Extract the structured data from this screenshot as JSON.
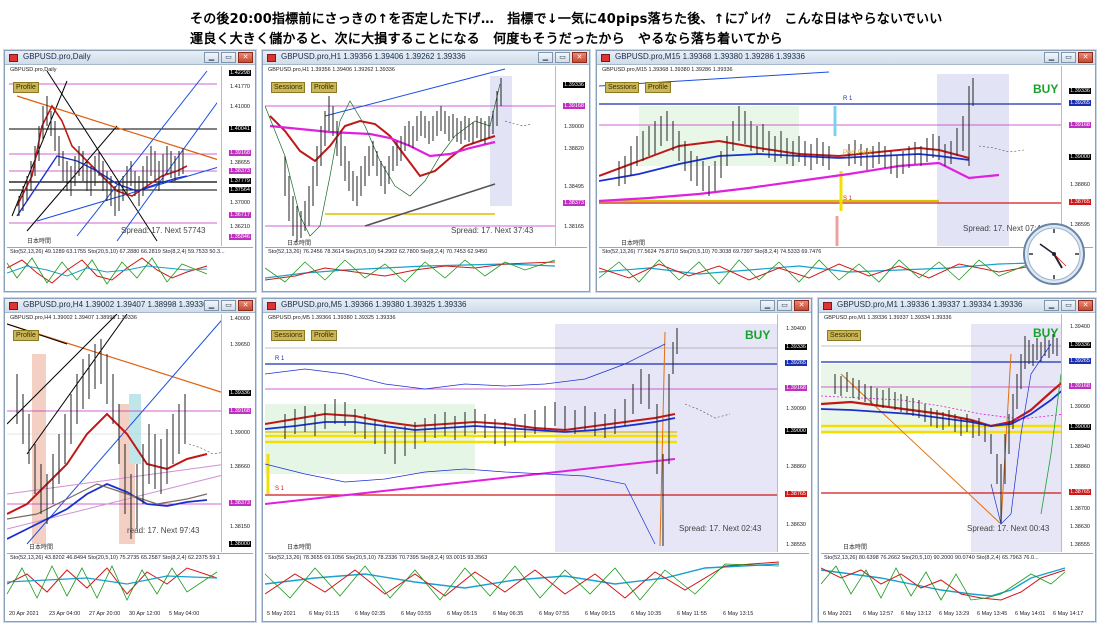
{
  "header": {
    "line1": "その後20:00指標前にさっきの↑を否定した下げ…　指標で↓一気に40pips落ちた後、↑にﾌﾞﾚｲｸ　こんな日はやらないでいい",
    "line2": "運良く大きく儲かると、次に大損することになる　何度もそうだったから　やるなら落ち着いてから"
  },
  "colors": {
    "buy": "#17a32a",
    "tag": "#c9b75a",
    "ma_red": "#c01818",
    "ma_blue": "#1a2fd0",
    "ma_magenta": "#e020e0",
    "price_box_blue": "#1a2fb0",
    "price_box_red": "#d01818"
  },
  "windows": [
    {
      "id": "daily",
      "title": "GBPUSD.pro,Daily",
      "tags": [
        "Profile"
      ],
      "prices": [
        "1.42298",
        "1.41770",
        "1.41000",
        "1.40041",
        "1.39168",
        "1.38655",
        "1.38373",
        "1.37779",
        "1.37564",
        "1.37000",
        "1.36717",
        "1.36210",
        "1.35846"
      ],
      "spread": "Spread: 17.  Next 57743",
      "session_label": "日本時間",
      "sub_label": "Sto(52,13,26) 49.1289 63.1755  Sto(20,5,10) 67.2880 66.2819  Sto(8,2,4) 59.7533 50.3...",
      "time_labels": []
    },
    {
      "id": "h1",
      "title": "GBPUSD.pro,H1  1.39356 1.39406 1.39262 1.39336",
      "tags": [
        "Sessions",
        "Profile"
      ],
      "prices": [
        "1.39336",
        "1.39168",
        "1.39000",
        "1.38820",
        "1.38495",
        "1.38373",
        "1.38165"
      ],
      "spread": "Spread: 17.  Next 37:43",
      "session_label": "日本時間",
      "sub_label": "Sto(52,13,26) 76.2456 78.3614  Sto(20,5,10) 54.2902 62.7800  Sto(8,2,4) 70.7453 62.9450",
      "time_labels": []
    },
    {
      "id": "m15",
      "title": "GBPUSD.pro,M15  1.39368 1.39380 1.39286 1.39336",
      "tags": [
        "Sessions",
        "Profile"
      ],
      "buy": "BUY",
      "pivot_labels": [
        "R 1",
        "S 1",
        "Pivot Point"
      ],
      "prices": [
        "1.39336",
        "1.39265",
        "1.39168",
        "1.39000",
        "1.38860",
        "1.38765",
        "1.38595"
      ],
      "spread": "Spread: 17.  Next 07:43",
      "session_label": "日本時間",
      "sub_label": "Sto(52,13,26) 77.5624 75.8710  Sto(20,5,10) 70.3038 69.7397  Sto(8,2,4) 74.5333 69.7476",
      "time_labels": []
    },
    {
      "id": "h4",
      "title": "GBPUSD.pro,H4  1.39002 1.39407 1.38998 1.39336",
      "tags": [
        "Profile"
      ],
      "prices": [
        "1.40000",
        "1.39650",
        "1.39336",
        "1.39168",
        "1.39000",
        "1.38660",
        "1.38373",
        "1.38150",
        "1.38000"
      ],
      "spread": "read: 17.  Next 97:43",
      "session_label": "日本時間",
      "sub_label": "Sto(52,13,26) 43.8202 46.8494  Sto(20,5,10) 75.2735 65.2587  Sto(8,2,4) 62.2375 59.1",
      "time_labels": [
        "20 Apr 2021",
        "23 Apr 04:00",
        "27 Apr 20:00",
        "30 Apr 12:00",
        "5 May 04:00"
      ]
    },
    {
      "id": "m5",
      "title": "GBPUSD.pro,M5  1.39366 1.39380 1.39325 1.39336",
      "tags": [
        "Sessions",
        "Profile"
      ],
      "buy": "BUY",
      "pivot_labels": [
        "R 1",
        "S 1"
      ],
      "prices": [
        "1.39400",
        "1.39336",
        "1.39265",
        "1.39168",
        "1.39090",
        "1.39000",
        "1.38860",
        "1.38765",
        "1.38630",
        "1.38555"
      ],
      "spread": "Spread: 17.  Next 02:43",
      "session_label": "日本時間",
      "sub_label": "Sto(52,13,26) 78.3655 69.1056  Sto(20,5,10) 78.2336 70.7395  Sto(8,2,4) 93.0015 93.3563",
      "time_labels": [
        "5 May 2021",
        "6 May 01:15",
        "6 May 02:35",
        "6 May 03:55",
        "6 May 05:15",
        "6 May 06:35",
        "6 May 07:55",
        "6 May 09:15",
        "6 May 10:35",
        "6 May 11:55",
        "6 May 13:15"
      ]
    },
    {
      "id": "m1",
      "title": "GBPUSD.pro,M1  1.39336 1.39337 1.39334 1.39336",
      "tags": [
        "Sessions"
      ],
      "buy": "BUY",
      "prices": [
        "1.39400",
        "1.39336",
        "1.39265",
        "1.39168",
        "1.39090",
        "1.39000",
        "1.38940",
        "1.38860",
        "1.38765",
        "1.38700",
        "1.38630",
        "1.38555"
      ],
      "spread": "Spread: 17.  Next 00:43",
      "session_label": "日本時間",
      "sub_label": "Sto(52,13,26) 80.6398 76.2662  Sto(20,5,10) 90.2000 90.0740  Sto(8,2,4) 65.7963 76.0...",
      "time_labels": [
        "6 May 2021",
        "6 May 12:57",
        "6 May 13:12",
        "6 May 13:29",
        "6 May 13:45",
        "6 May 14:01",
        "6 May 14:17"
      ]
    }
  ]
}
